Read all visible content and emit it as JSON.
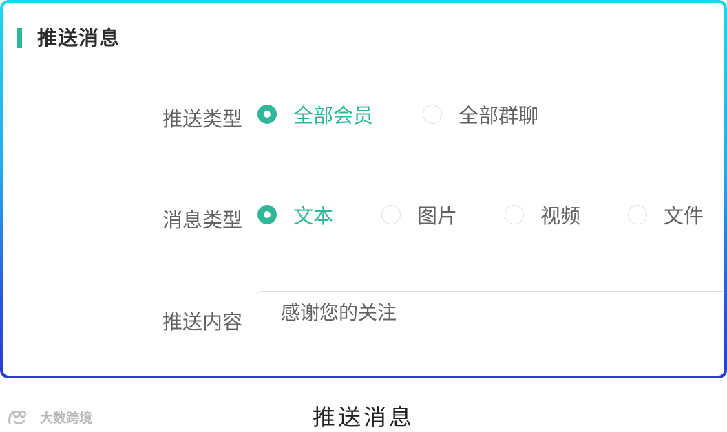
{
  "card": {
    "title": "推送消息"
  },
  "form": {
    "push_type": {
      "label": "推送类型",
      "options": [
        {
          "label": "全部会员",
          "checked": true
        },
        {
          "label": "全部群聊",
          "checked": false
        }
      ]
    },
    "message_type": {
      "label": "消息类型",
      "options": [
        {
          "label": "文本",
          "checked": true
        },
        {
          "label": "图片",
          "checked": false
        },
        {
          "label": "视频",
          "checked": false
        },
        {
          "label": "文件",
          "checked": false
        }
      ]
    },
    "content": {
      "label": "推送内容",
      "value": "感谢您的关注"
    }
  },
  "caption": "推送消息",
  "watermark": {
    "text": "大数跨境"
  },
  "colors": {
    "accent": "#2fb69b",
    "label": "#606266",
    "border_gradient_top": "#1fd6ef",
    "border_gradient_bottom": "#2a3bd0"
  }
}
